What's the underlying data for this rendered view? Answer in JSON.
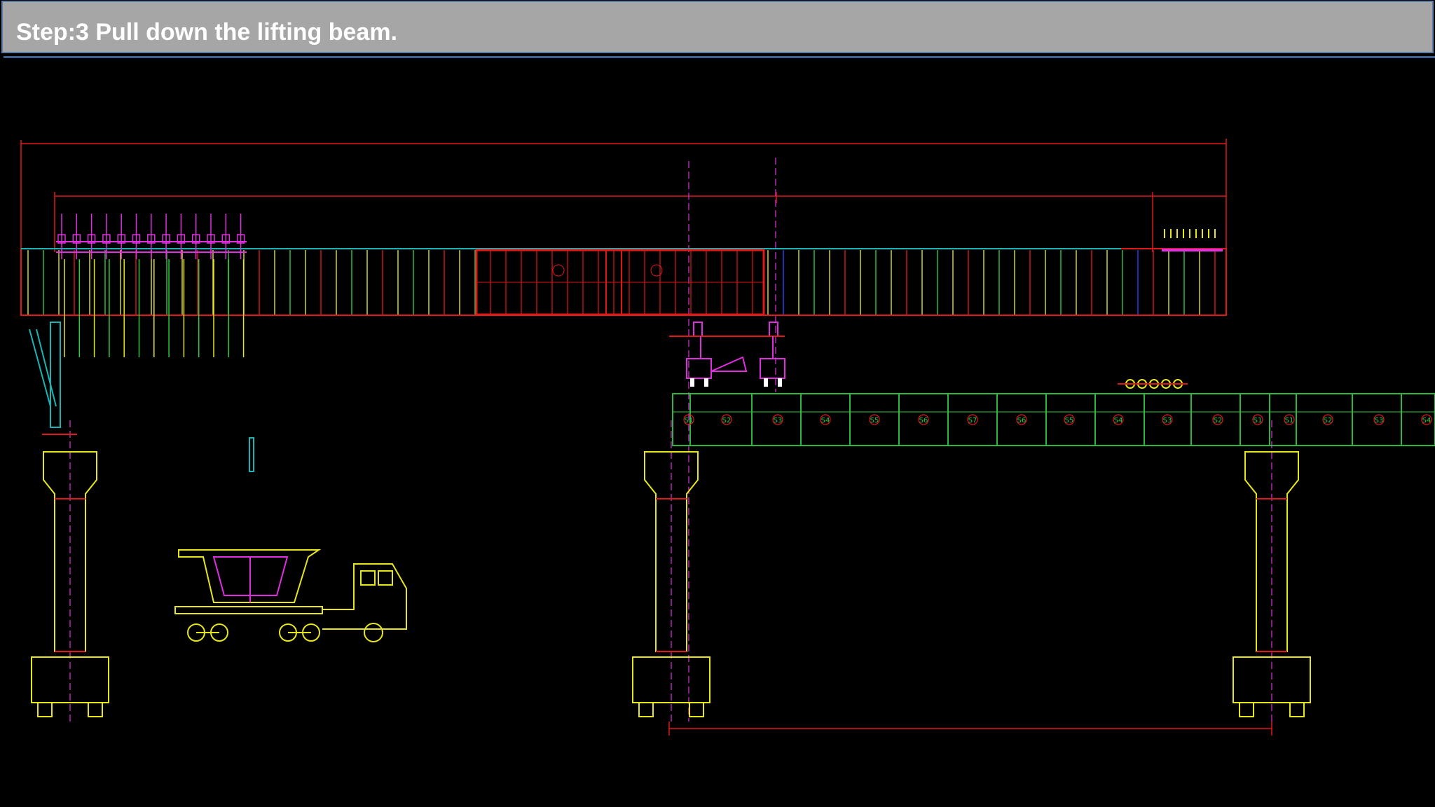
{
  "slide": {
    "title": "Step:3 Pull down the lifting beam."
  },
  "drawing": {
    "segment_labels": [
      "S1",
      "S2",
      "S3",
      "S4",
      "S5",
      "S6",
      "S7",
      "S6",
      "S5",
      "S4",
      "S3",
      "S2",
      "S1",
      "S1",
      "S2",
      "S3",
      "S4"
    ],
    "colors": {
      "background": "#000000",
      "red": "#e01818",
      "green": "#2ecc40",
      "yellow": "#e6e61a",
      "magenta": "#e02ee0",
      "cyan": "#19b4b4",
      "blue": "#2a46ff",
      "title_bar": "#a6a6a6"
    }
  }
}
